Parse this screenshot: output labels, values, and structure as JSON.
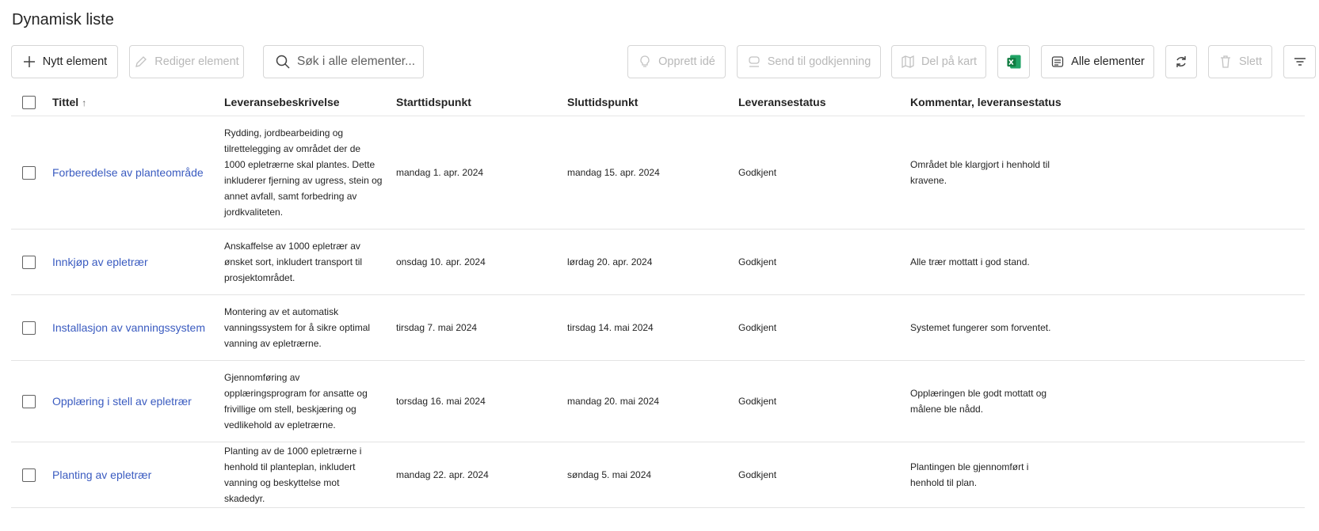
{
  "page": {
    "title": "Dynamisk liste"
  },
  "toolbar": {
    "new_item": "Nytt element",
    "edit_item": "Rediger element",
    "search_placeholder": "Søk i alle elementer...",
    "create_idea": "Opprett idé",
    "send_approval": "Send til godkjenning",
    "share_map": "Del på kart",
    "all_items": "Alle elementer",
    "delete": "Slett"
  },
  "table": {
    "columns": [
      "Tittel",
      "Leveransebeskrivelse",
      "Starttidspunkt",
      "Sluttidspunkt",
      "Leveransestatus",
      "Kommentar, leveransestatus"
    ],
    "rows": [
      {
        "title": "Forberedelse av planteområde",
        "desc": "Rydding, jordbearbeiding og tilrettelegging av området der de 1000 epletrærne skal plantes. Dette inkluderer fjerning av ugress, stein og annet avfall, samt forbedring av jordkvaliteten.",
        "start": "mandag 1. apr. 2024",
        "end": "mandag 15. apr. 2024",
        "status": "Godkjent",
        "comment": "Området ble klargjort i henhold til kravene."
      },
      {
        "title": "Innkjøp av epletrær",
        "desc": "Anskaffelse av 1000 epletrær av ønsket sort, inkludert transport til prosjektområdet.",
        "start": "onsdag 10. apr. 2024",
        "end": "lørdag 20. apr. 2024",
        "status": "Godkjent",
        "comment": "Alle trær mottatt i god stand."
      },
      {
        "title": "Installasjon av vanningssystem",
        "desc": "Montering av et automatisk vanningssystem for å sikre optimal vanning av epletrærne.",
        "start": "tirsdag 7. mai 2024",
        "end": "tirsdag 14. mai 2024",
        "status": "Godkjent",
        "comment": "Systemet fungerer som forventet."
      },
      {
        "title": "Opplæring i stell av epletrær",
        "desc": "Gjennomføring av opplæringsprogram for ansatte og frivillige om stell, beskjæring og vedlikehold av epletrærne.",
        "start": "torsdag 16. mai 2024",
        "end": "mandag 20. mai 2024",
        "status": "Godkjent",
        "comment": "Opplæringen ble godt mottatt og målene ble nådd."
      },
      {
        "title": "Planting av epletrær",
        "desc": "Planting av de 1000 epletrærne i henhold til planteplan, inkludert vanning og beskyttelse mot skadedyr.",
        "start": "mandag 22. apr. 2024",
        "end": "søndag 5. mai 2024",
        "status": "Godkjent",
        "comment": "Plantingen ble gjennomført i henhold til plan."
      }
    ]
  }
}
